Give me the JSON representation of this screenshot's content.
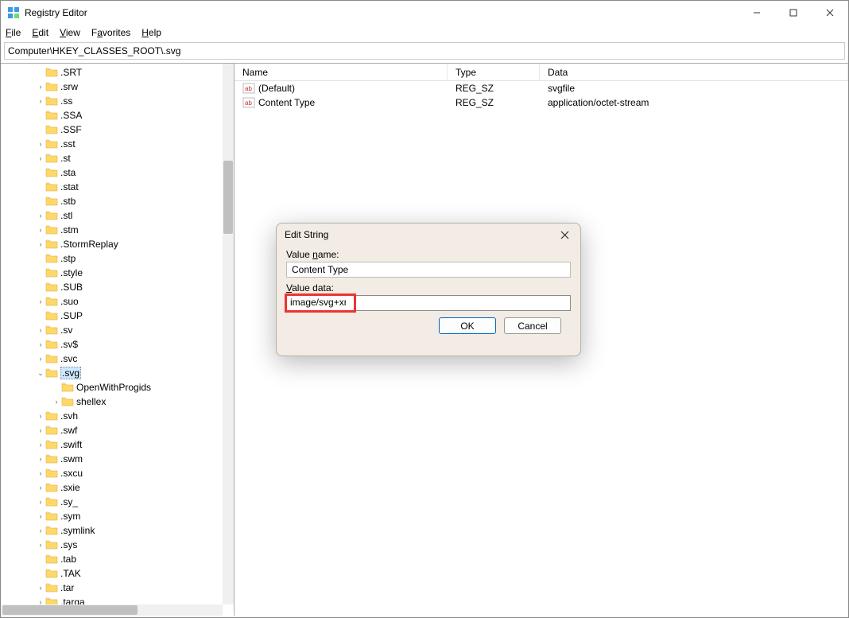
{
  "window": {
    "title": "Registry Editor"
  },
  "menu": {
    "file": "File",
    "edit": "Edit",
    "view": "View",
    "favorites": "Favorites",
    "help": "Help"
  },
  "address": "Computer\\HKEY_CLASSES_ROOT\\.svg",
  "tree": {
    "items": [
      {
        "label": ".SRT",
        "exp": "none",
        "depth": 1
      },
      {
        "label": ".srw",
        "exp": ">",
        "depth": 1
      },
      {
        "label": ".ss",
        "exp": ">",
        "depth": 1
      },
      {
        "label": ".SSA",
        "exp": "none",
        "depth": 1
      },
      {
        "label": ".SSF",
        "exp": "none",
        "depth": 1
      },
      {
        "label": ".sst",
        "exp": ">",
        "depth": 1
      },
      {
        "label": ".st",
        "exp": ">",
        "depth": 1
      },
      {
        "label": ".sta",
        "exp": "none",
        "depth": 1
      },
      {
        "label": ".stat",
        "exp": "none",
        "depth": 1
      },
      {
        "label": ".stb",
        "exp": "none",
        "depth": 1
      },
      {
        "label": ".stl",
        "exp": ">",
        "depth": 1
      },
      {
        "label": ".stm",
        "exp": ">",
        "depth": 1
      },
      {
        "label": ".StormReplay",
        "exp": ">",
        "depth": 1
      },
      {
        "label": ".stp",
        "exp": "none",
        "depth": 1
      },
      {
        "label": ".style",
        "exp": "none",
        "depth": 1
      },
      {
        "label": ".SUB",
        "exp": "none",
        "depth": 1
      },
      {
        "label": ".suo",
        "exp": ">",
        "depth": 1
      },
      {
        "label": ".SUP",
        "exp": "none",
        "depth": 1
      },
      {
        "label": ".sv",
        "exp": ">",
        "depth": 1
      },
      {
        "label": ".sv$",
        "exp": ">",
        "depth": 1
      },
      {
        "label": ".svc",
        "exp": ">",
        "depth": 1
      },
      {
        "label": ".svg",
        "exp": "v",
        "depth": 1,
        "selected": true
      },
      {
        "label": "OpenWithProgids",
        "exp": "",
        "depth": 2
      },
      {
        "label": "shellex",
        "exp": ">",
        "depth": 2
      },
      {
        "label": ".svh",
        "exp": ">",
        "depth": 1
      },
      {
        "label": ".swf",
        "exp": ">",
        "depth": 1
      },
      {
        "label": ".swift",
        "exp": ">",
        "depth": 1
      },
      {
        "label": ".swm",
        "exp": ">",
        "depth": 1
      },
      {
        "label": ".sxcu",
        "exp": ">",
        "depth": 1
      },
      {
        "label": ".sxie",
        "exp": ">",
        "depth": 1
      },
      {
        "label": ".sy_",
        "exp": ">",
        "depth": 1
      },
      {
        "label": ".sym",
        "exp": ">",
        "depth": 1
      },
      {
        "label": ".symlink",
        "exp": ">",
        "depth": 1
      },
      {
        "label": ".sys",
        "exp": ">",
        "depth": 1
      },
      {
        "label": ".tab",
        "exp": "none",
        "depth": 1
      },
      {
        "label": ".TAK",
        "exp": "none",
        "depth": 1
      },
      {
        "label": ".tar",
        "exp": ">",
        "depth": 1
      },
      {
        "label": ".targa",
        "exp": ">",
        "depth": 1
      }
    ]
  },
  "list": {
    "headers": {
      "name": "Name",
      "type": "Type",
      "data": "Data"
    },
    "rows": [
      {
        "name": "(Default)",
        "type": "REG_SZ",
        "data": "svgfile"
      },
      {
        "name": "Content Type",
        "type": "REG_SZ",
        "data": "application/octet-stream"
      }
    ]
  },
  "dialog": {
    "title": "Edit String",
    "value_name_label": "Value name:",
    "value_name": "Content Type",
    "value_data_label": "Value data:",
    "value_data": "image/svg+xml",
    "ok": "OK",
    "cancel": "Cancel"
  }
}
